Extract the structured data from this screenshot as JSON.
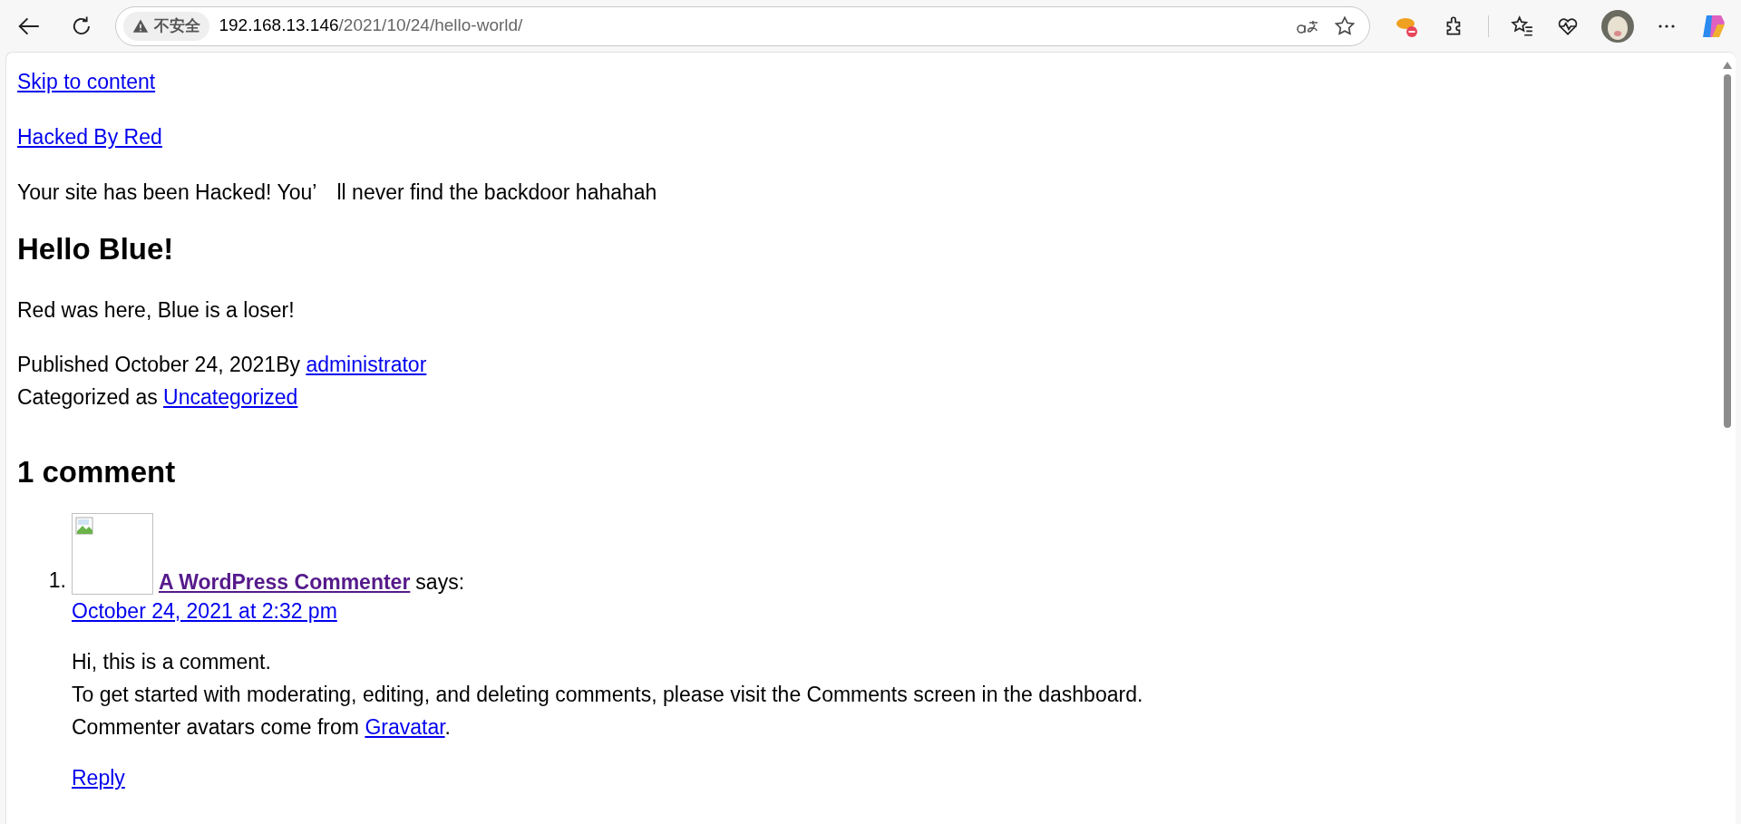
{
  "browser": {
    "security_label": "不安全",
    "url_host": "192.168.13.146",
    "url_path": "/2021/10/24/hello-world/"
  },
  "page": {
    "skip_link": "Skip to content",
    "site_title": "Hacked By Red",
    "site_description": "Your site has been Hacked! You’　ll never find the backdoor hahahah",
    "post": {
      "title": "Hello Blue!",
      "body": "Red was here, Blue is a loser!",
      "published_prefix": "Published October 24, 2021By",
      "author": "administrator",
      "category_prefix": "Categorized as",
      "category": "Uncategorized"
    },
    "comments": {
      "heading": "1 comment",
      "items": [
        {
          "number": "1.",
          "author": "A WordPress Commenter",
          "author_visited": true,
          "says": "says:",
          "date": "October 24, 2021 at 2:32 pm",
          "lines": [
            "Hi, this is a comment.",
            "To get started with moderating, editing, and deleting comments, please visit the Comments screen in the dashboard."
          ],
          "last_line_prefix": "Commenter avatars come from",
          "last_line_link": "Gravatar",
          "last_line_suffix": ".",
          "reply": "Reply"
        }
      ]
    }
  }
}
